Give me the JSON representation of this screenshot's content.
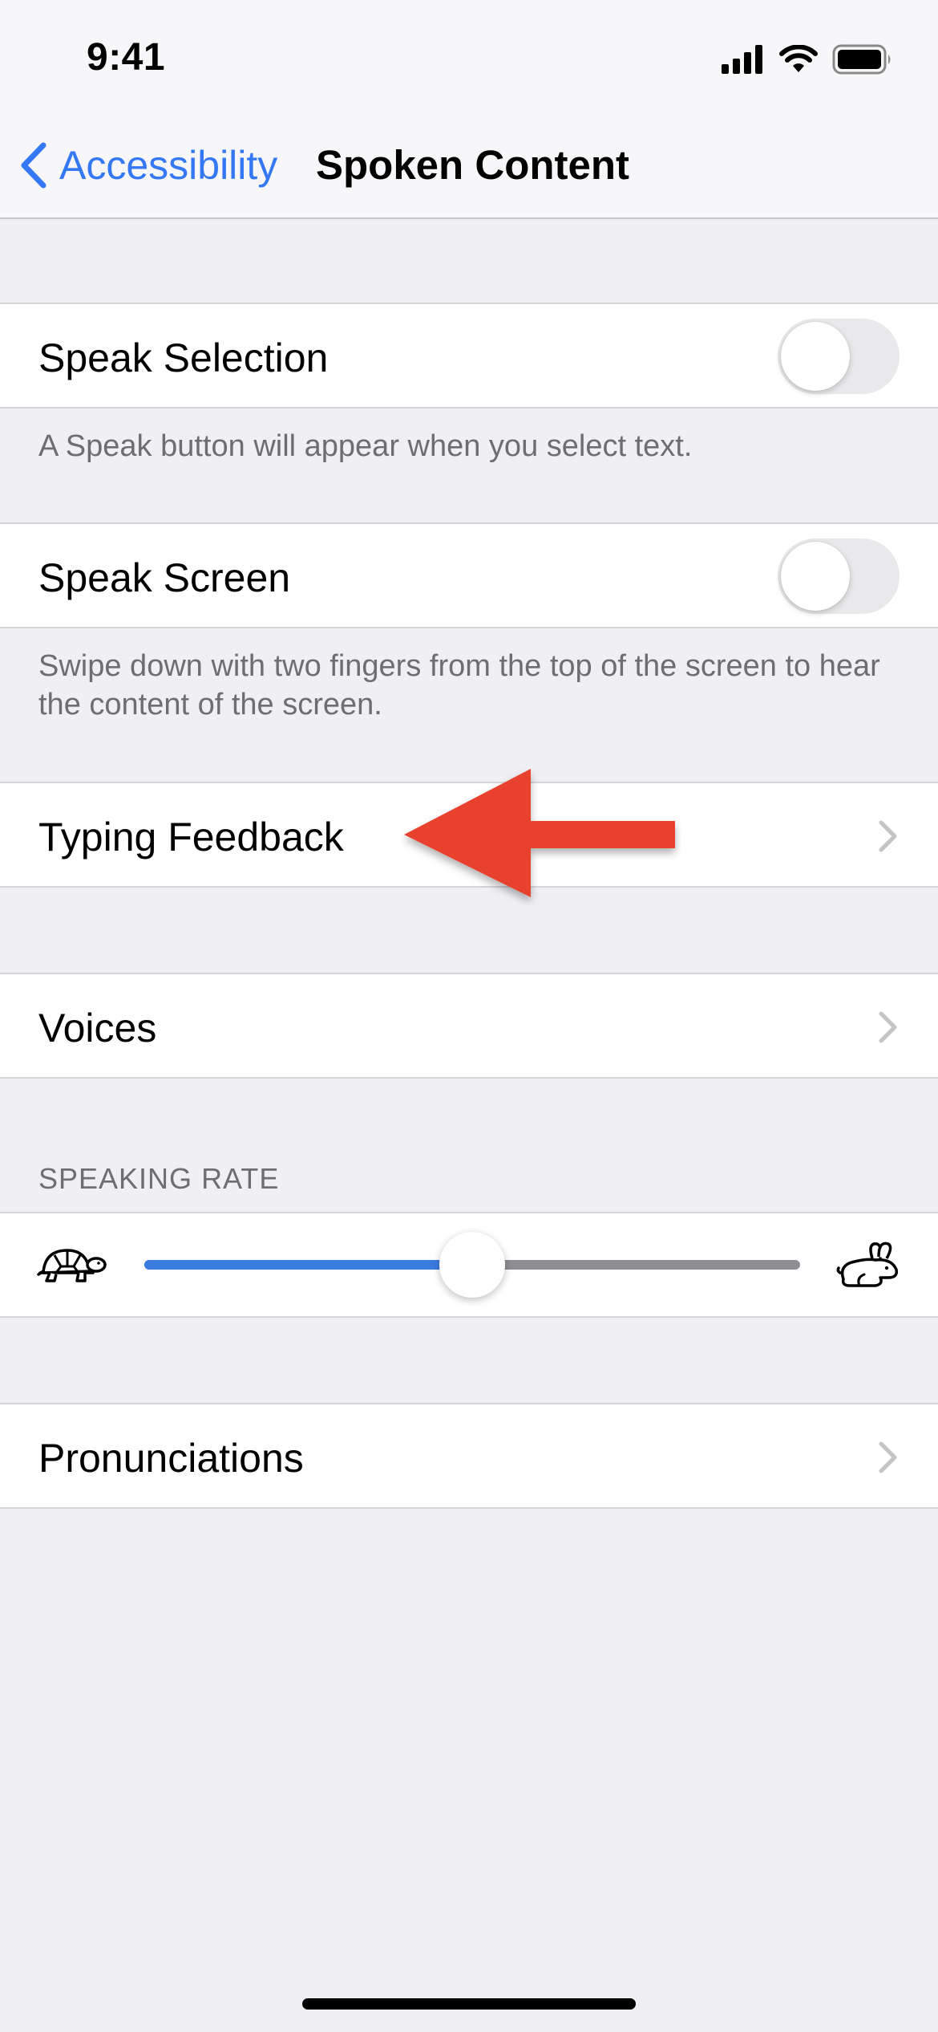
{
  "status": {
    "time": "9:41"
  },
  "nav": {
    "back_label": "Accessibility",
    "title": "Spoken Content"
  },
  "speak_selection": {
    "label": "Speak Selection",
    "enabled": false,
    "footnote": "A Speak button will appear when you select text."
  },
  "speak_screen": {
    "label": "Speak Screen",
    "enabled": false,
    "footnote": "Swipe down with two fingers from the top of the screen to hear the content of the screen."
  },
  "typing_feedback": {
    "label": "Typing Feedback"
  },
  "voices": {
    "label": "Voices"
  },
  "speaking_rate": {
    "header": "SPEAKING RATE",
    "value_fraction": 0.5,
    "min_icon": "turtle-icon",
    "max_icon": "rabbit-icon"
  },
  "pronunciations": {
    "label": "Pronunciations"
  },
  "annotation": {
    "type": "arrow",
    "color": "#e8432d"
  },
  "colors": {
    "accent": "#3478f6",
    "slider_fill": "#3a7be0"
  }
}
